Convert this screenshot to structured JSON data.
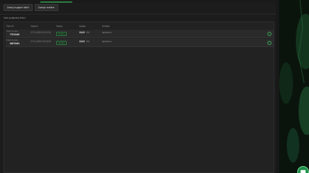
{
  "toolbar": {
    "tabs": [
      "Zadnji kupljeni listići",
      "Zadnje dobitne"
    ]
  },
  "section_title": "Vaši posljednji listići",
  "table": {
    "headers": [
      "Tiket ID",
      "Vrijeme",
      "Status",
      "Uplata",
      "Dobitak"
    ],
    "rows": [
      {
        "id_label": "TIKET ID 2021",
        "id": "77813440",
        "time": "27.01.2023 15:22:31",
        "status": "Dobitni",
        "stake": "10,00",
        "currency": "KM",
        "win": "Isplaćeno"
      },
      {
        "id_label": "TIKET ID 2021",
        "id": "36879461",
        "time": "27.01.2023 15:15:03",
        "status": "Dobitni",
        "stake": "10,00",
        "currency": "KM",
        "win": "Isplaćeno"
      }
    ]
  },
  "colors": {
    "accent": "#2f7d43",
    "status_green": "#4aa35f",
    "background": "#1c1c1c"
  },
  "icons": {
    "row_action": "check-circle-icon",
    "chat": "chat-bubble-icon"
  }
}
